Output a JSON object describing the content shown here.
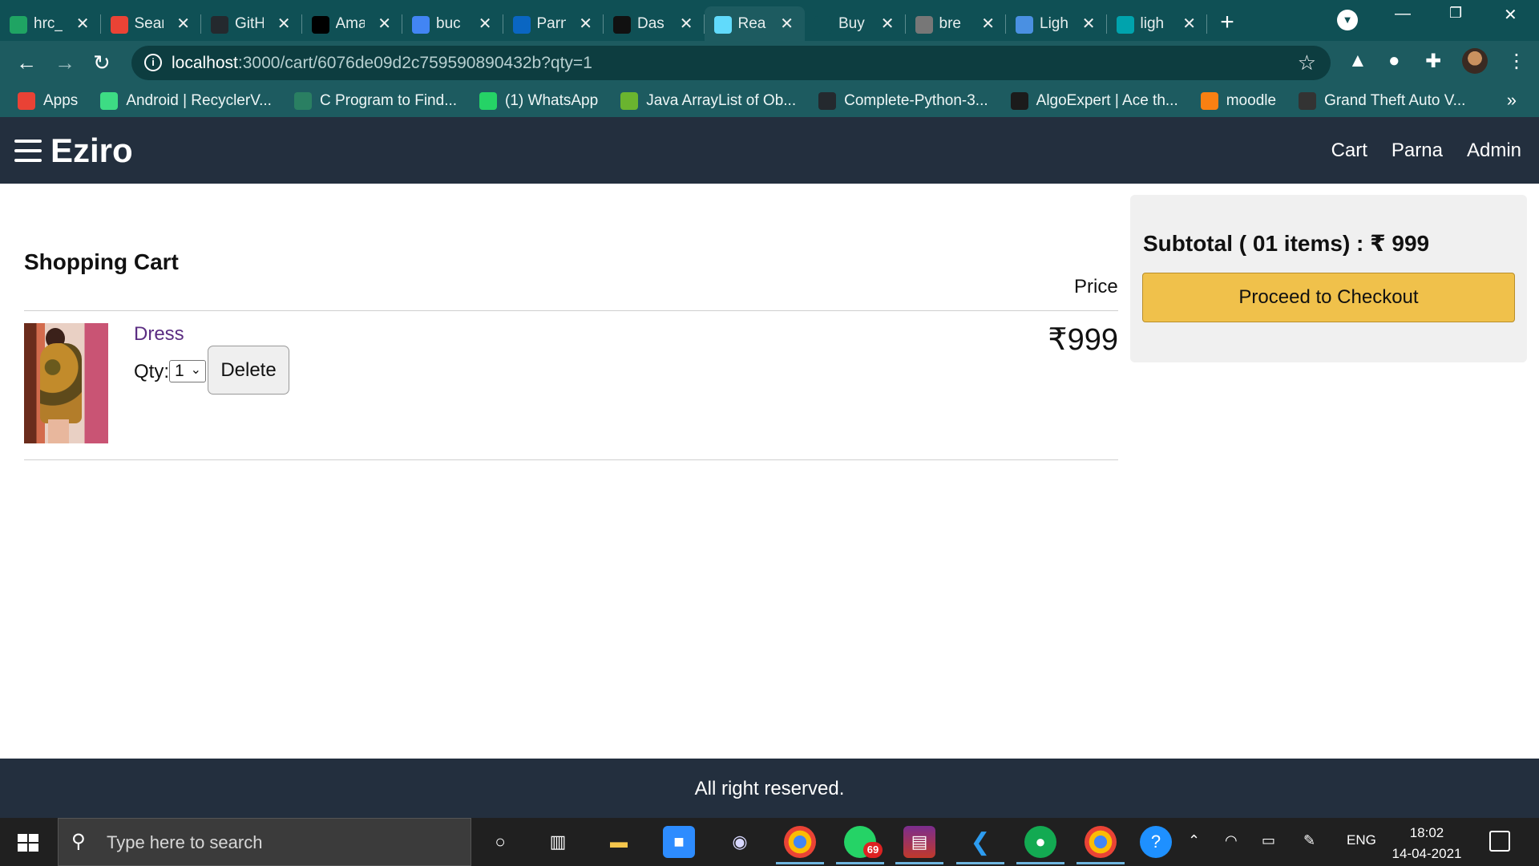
{
  "browser": {
    "tabs": [
      {
        "title": "hrc_",
        "icon": "google-drive-icon",
        "color": "#1fa463"
      },
      {
        "title": "Sear",
        "icon": "gmail-icon",
        "color": "#ea4335"
      },
      {
        "title": "GitH",
        "icon": "github-icon",
        "color": "#24292e"
      },
      {
        "title": "Ama",
        "icon": "amazon-icon",
        "color": "#000000"
      },
      {
        "title": "buc",
        "icon": "google-icon",
        "color": "#4285f4"
      },
      {
        "title": "Parn",
        "icon": "linkedin-icon",
        "color": "#0a66c2"
      },
      {
        "title": "Das",
        "icon": "dashboard-icon",
        "color": "#111111"
      },
      {
        "title": "Rea",
        "icon": "react-icon",
        "color": "#61dafb",
        "active": true
      },
      {
        "title": "Buy",
        "icon": "shop-icon",
        "color": "#0f5055"
      },
      {
        "title": "bre",
        "icon": "globe-icon",
        "color": "#777777"
      },
      {
        "title": "Ligh",
        "icon": "color-icon",
        "color": "#4a90e2"
      },
      {
        "title": "ligh",
        "icon": "c-icon",
        "color": "#00a3ad"
      }
    ],
    "new_tab": "+",
    "url_host": "localhost",
    "url_rest": ":3000/cart/6076de09d2c759590890432b?qty=1",
    "bookmarks": [
      {
        "label": "Apps",
        "icon": "apps-grid-icon",
        "color": "#e94235"
      },
      {
        "label": "Android | RecyclerV...",
        "icon": "android-icon",
        "color": "#3ddc84"
      },
      {
        "label": "C Program to Find...",
        "icon": "site-icon",
        "color": "#2a7f62"
      },
      {
        "label": "(1) WhatsApp",
        "icon": "whatsapp-icon",
        "color": "#25d366"
      },
      {
        "label": "Java ArrayList of Ob...",
        "icon": "b-icon",
        "color": "#6ab42f"
      },
      {
        "label": "Complete-Python-3...",
        "icon": "github-icon",
        "color": "#24292e"
      },
      {
        "label": "AlgoExpert | Ace th...",
        "icon": "algoexpert-icon",
        "color": "#1b1b1b"
      },
      {
        "label": "moodle",
        "icon": "moodle-icon",
        "color": "#f98012"
      },
      {
        "label": "Grand Theft Auto V...",
        "icon": "epic-icon",
        "color": "#333333"
      }
    ]
  },
  "app": {
    "brand": "Eziro",
    "nav": {
      "cart": "Cart",
      "user": "Parna",
      "admin": "Admin"
    }
  },
  "cart": {
    "title": "Shopping Cart",
    "price_header": "Price",
    "items": [
      {
        "name": "Dress",
        "qty_label": "Qty:",
        "qty_value": "1",
        "delete_label": "Delete",
        "price": "₹999"
      }
    ]
  },
  "summary": {
    "subtotal_text": "Subtotal ( 01 items) : ₹ 999",
    "checkout_label": "Proceed to Checkout"
  },
  "footer": {
    "text": "All right reserved."
  },
  "taskbar": {
    "search_placeholder": "Type here to search",
    "whatsapp_badge": "69",
    "language": "ENG",
    "time": "18:02",
    "date": "14-04-2021"
  },
  "colors": {
    "navbar": "#232f3e",
    "checkout": "#f0c14b",
    "item_link": "#5b2d82",
    "chrome": "#1d5b60"
  }
}
